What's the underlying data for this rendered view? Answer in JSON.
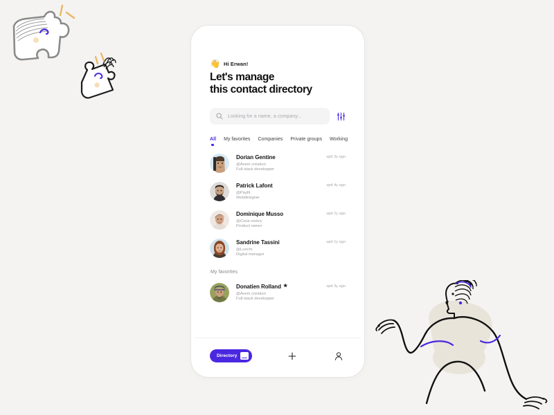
{
  "canvas": {
    "background_color": "#f4f3f1",
    "accent_color": "#4a28e1"
  },
  "decorations": [
    {
      "name": "puzzle-character-left",
      "description": "hand-drawn grey puzzle piece character with face"
    },
    {
      "name": "puzzle-character-right",
      "description": "hand-drawn black puzzle piece character with hair"
    },
    {
      "name": "woman-illustration",
      "description": "hand-drawn line-art woman leaning, beige body"
    }
  ],
  "app": {
    "header": {
      "wave_icon": "👋",
      "greeting": "Hi Erwan!",
      "headline_line1": "Let's manage",
      "headline_line2": "this contact directory"
    },
    "search": {
      "icon": "search-icon",
      "placeholder": "Looking for a name, a company...",
      "value": "",
      "filter_icon": "sliders-icon"
    },
    "tabs": [
      {
        "label": "All",
        "active": true
      },
      {
        "label": "My favorites",
        "active": false
      },
      {
        "label": "Companies",
        "active": false
      },
      {
        "label": "Private groups",
        "active": false
      },
      {
        "label": "Working",
        "active": false
      }
    ],
    "contacts": [
      {
        "name": "Dorian Gentine",
        "company": "@Avem création",
        "role": "Full-stack developper",
        "updated": "upd 3y ago",
        "favorite": false,
        "avatar": "illustrated-man-blue"
      },
      {
        "name": "Patrick Lafont",
        "company": "@Payfit",
        "role": "Webdesigner",
        "updated": "upd 4y ago",
        "favorite": false,
        "avatar": "photo-bearded-man"
      },
      {
        "name": "Dominique Musso",
        "company": "@Cosa vostra",
        "role": "Product owner",
        "updated": "upd 1y ago",
        "favorite": false,
        "avatar": "photo-dark-hair-man"
      },
      {
        "name": "Sandrine Tassini",
        "company": "@Lunchr",
        "role": "Digital manager",
        "updated": "upd 1y ago",
        "favorite": false,
        "avatar": "photo-red-hair-woman"
      }
    ],
    "favorites_section": {
      "label": "My favorites",
      "contacts": [
        {
          "name": "Donatien Rolland",
          "star": "★",
          "company": "@Avem création",
          "role": "Full-stack developper",
          "updated": "upd 3y ago",
          "favorite": true,
          "avatar": "photo-man-cap"
        }
      ]
    },
    "bottom_nav": {
      "directory_label": "Directory",
      "directory_icon": "book-icon",
      "add_icon": "plus-icon",
      "profile_icon": "person-icon"
    }
  }
}
